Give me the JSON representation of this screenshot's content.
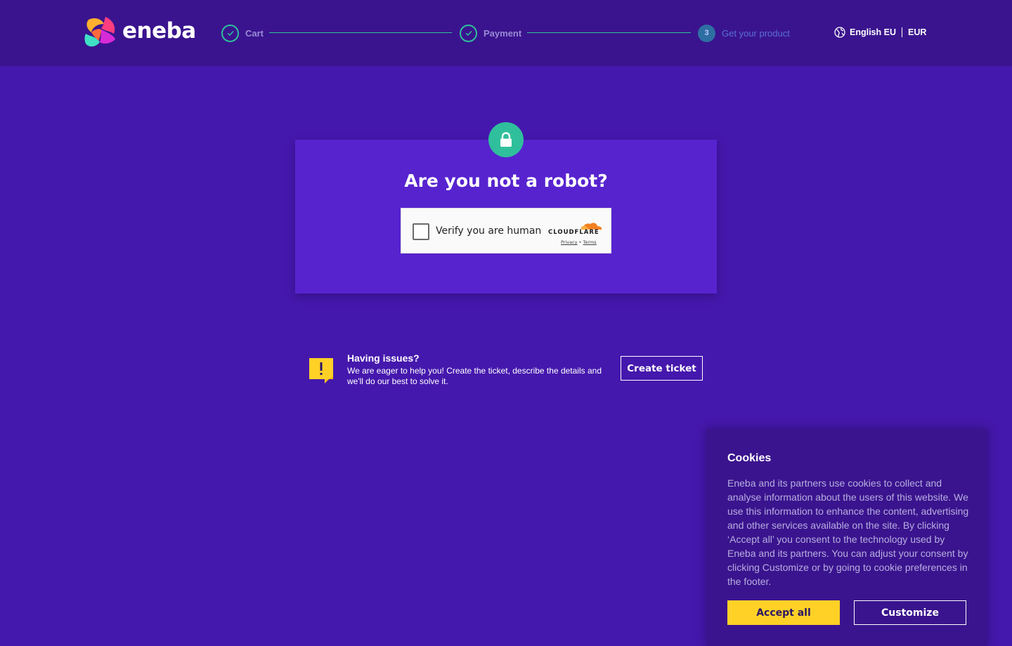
{
  "header": {
    "brand": "eneba",
    "steps": [
      {
        "label": "Cart",
        "state": "done"
      },
      {
        "label": "Payment",
        "state": "done"
      },
      {
        "label": "Get your product",
        "state": "current",
        "number": "3"
      }
    ],
    "language": "English EU",
    "currency": "EUR"
  },
  "card": {
    "title": "Are you not a robot?",
    "captcha": {
      "label": "Verify you are human",
      "provider": "CLOUDFLARE",
      "privacy": "Privacy",
      "separator": "•",
      "terms": "Terms"
    }
  },
  "issues": {
    "title": "Having issues?",
    "description": "We are eager to help you! Create the ticket, describe the details and we'll do our best to solve it.",
    "button": "Create ticket"
  },
  "cookies": {
    "title": "Cookies",
    "text": "Eneba and its partners use cookies to collect and analyse information about the users of this website. We use this information to enhance the content, advertising and other services available on the site. By clicking ‘Accept all’ you consent to the technology used by Eneba and its partners. You can adjust your consent by clicking Customize or by going to cookie preferences in the footer.",
    "accept": "Accept all",
    "customize": "Customize"
  },
  "colors": {
    "background": "#4518ad",
    "header": "#3a148e",
    "card": "#5723cf",
    "accent_green": "#2fbf9c",
    "accent_yellow": "#ffd126"
  },
  "icons": {
    "brand": "eneba-logo-icon",
    "step_done": "check-circle-icon",
    "language": "globe-icon",
    "card": "lock-icon",
    "issues": "warning-speech-icon",
    "captcha_provider": "cloud-icon"
  }
}
